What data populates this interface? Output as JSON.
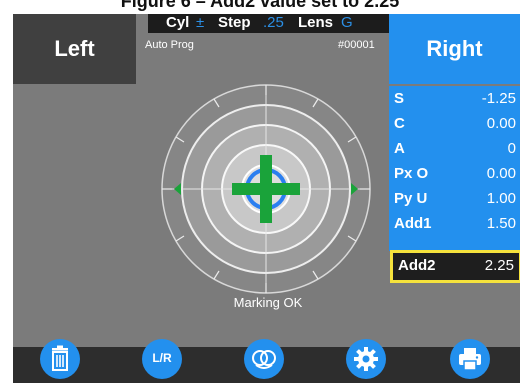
{
  "caption": "Figure 6 – Add2 value set to 2.25",
  "topbar": {
    "cyl_label": "Cyl",
    "cyl_value": "±",
    "step_label": "Step",
    "step_value": ".25",
    "lens_label": "Lens",
    "lens_value": "G"
  },
  "left_button": "Left",
  "right_button": "Right",
  "mode": "Auto Prog",
  "record_id": "#00001",
  "measurements": [
    {
      "label": "S",
      "value": "-1.25"
    },
    {
      "label": "C",
      "value": "0.00"
    },
    {
      "label": "A",
      "value": "0"
    },
    {
      "label": "Px O",
      "value": "0.00"
    },
    {
      "label": "Py U",
      "value": "1.00"
    },
    {
      "label": "Add1",
      "value": "1.50"
    }
  ],
  "add2": {
    "label": "Add2",
    "value": "2.25"
  },
  "status": "Marking OK",
  "toolbar": {
    "lr_label": "L/R",
    "icons": [
      "trash-icon",
      "lr-icon",
      "lens-icon",
      "gear-icon",
      "printer-icon"
    ]
  },
  "colors": {
    "accent_blue": "#2390ee",
    "screen_gray": "#7b7b7b",
    "crosshair_green": "#1aa33a",
    "highlight_yellow": "#f5e23c"
  }
}
